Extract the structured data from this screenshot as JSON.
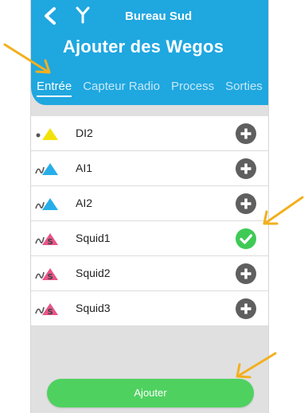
{
  "header": {
    "site_name": "Bureau Sud",
    "title": "Ajouter des Wegos",
    "back_icon": "chevron-left-icon",
    "logo_icon": "wego-logo-icon",
    "color": "#1fa7e0"
  },
  "tabs": [
    {
      "label": "Entrée",
      "active": true
    },
    {
      "label": "Capteur Radio",
      "active": false
    },
    {
      "label": "Process",
      "active": false
    },
    {
      "label": "Sorties",
      "active": false
    }
  ],
  "items": [
    {
      "label": "DI2",
      "icon": "digital-input-icon",
      "icon_color": "#f2e20a",
      "action": "add"
    },
    {
      "label": "AI1",
      "icon": "analog-input-icon",
      "icon_color": "#27aee8",
      "action": "add"
    },
    {
      "label": "AI2",
      "icon": "analog-input-icon",
      "icon_color": "#27aee8",
      "action": "add"
    },
    {
      "label": "Squid1",
      "icon": "squid-sensor-icon",
      "icon_color": "#e8548a",
      "action": "added"
    },
    {
      "label": "Squid2",
      "icon": "squid-sensor-icon",
      "icon_color": "#e8548a",
      "action": "add"
    },
    {
      "label": "Squid3",
      "icon": "squid-sensor-icon",
      "icon_color": "#e8548a",
      "action": "add"
    }
  ],
  "footer": {
    "add_label": "Ajouter",
    "color": "#4fd160"
  },
  "annotation_color": "#f2b01e"
}
